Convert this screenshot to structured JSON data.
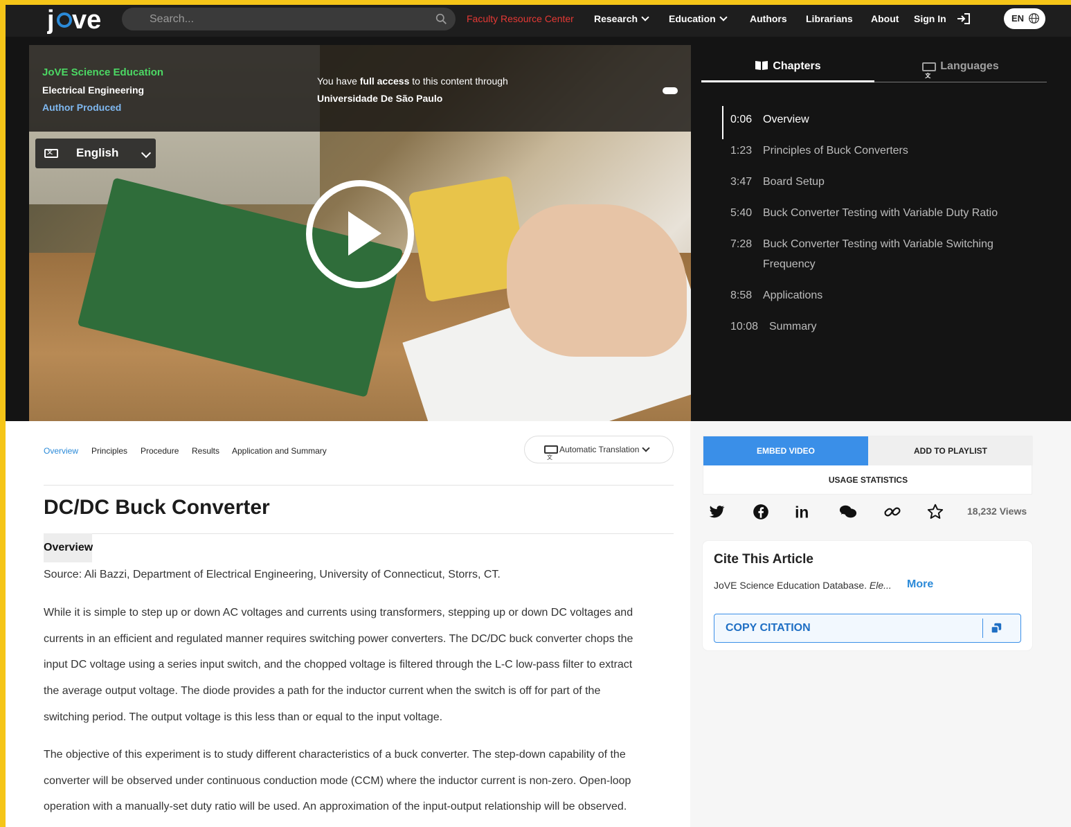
{
  "nav": {
    "logo": "jove",
    "search_placeholder": "Search...",
    "links": {
      "faculty": "Faculty Resource Center",
      "research": "Research",
      "education": "Education",
      "authors": "Authors",
      "librarians": "Librarians",
      "about": "About",
      "signin": "Sign In"
    },
    "lang": "EN"
  },
  "video": {
    "brand": "JoVE Science Education",
    "category": "Electrical Engineering",
    "produced": "Author Produced",
    "access_prefix": "You have ",
    "access_bold": "full access",
    "access_suffix": " to this content through",
    "institution": "Universidade De São Paulo",
    "language": "English"
  },
  "side": {
    "tab_chapters": "Chapters",
    "tab_languages": "Languages",
    "chapters": [
      {
        "time": "0:06",
        "title": "Overview"
      },
      {
        "time": "1:23",
        "title": "Principles of Buck Converters"
      },
      {
        "time": "3:47",
        "title": "Board Setup"
      },
      {
        "time": "5:40",
        "title": "Buck Converter Testing with Variable Duty Ratio"
      },
      {
        "time": "7:28",
        "title": "Buck Converter Testing with Variable Switching Frequency"
      },
      {
        "time": "8:58",
        "title": "Applications"
      },
      {
        "time": "10:08",
        "title": "Summary"
      }
    ]
  },
  "article": {
    "tabs": [
      "Overview",
      "Principles",
      "Procedure",
      "Results",
      "Application and Summary"
    ],
    "auto_translation": "Automatic Translation",
    "title": "DC/DC Buck Converter",
    "section": "Overview",
    "source": "Source: Ali Bazzi, Department of Electrical Engineering, University of Connecticut, Storrs, CT.",
    "para1": [
      "While it is simple to step up or down AC voltages and currents using transformers, stepping up or down DC voltages and",
      "currents in an efficient and regulated manner requires switching power converters. The DC/DC buck converter chops the",
      "input DC voltage using a series input switch, and the chopped voltage is filtered through the L-C low-pass filter to extract",
      "the average output voltage. The diode provides a path for the inductor current when the switch is off for part of the",
      "switching period. The output voltage is this less than or equal to the input voltage."
    ],
    "para2": [
      "The objective of this experiment is to study different characteristics of a buck converter. The step-down capability of the",
      "converter will be observed under continuous conduction mode (CCM) where the inductor current is non-zero. Open-loop",
      "operation with a manually-set duty ratio will be used. An approximation of the input-output relationship will be observed."
    ]
  },
  "actions": {
    "embed": "EMBED VIDEO",
    "playlist": "ADD TO PLAYLIST",
    "usage": "USAGE STATISTICS",
    "views": "18,232 Views"
  },
  "cite": {
    "title": "Cite This Article",
    "text_prefix": "JoVE Science Education Database. ",
    "text_italic": "Ele...",
    "more": "More",
    "copy": "COPY CITATION"
  },
  "colors": {
    "accent": "#2b8ad8",
    "nav_bg": "#1e1e1e",
    "frame": "#f5c518",
    "brand_green": "#4cd964",
    "faculty_red": "#e53935"
  }
}
